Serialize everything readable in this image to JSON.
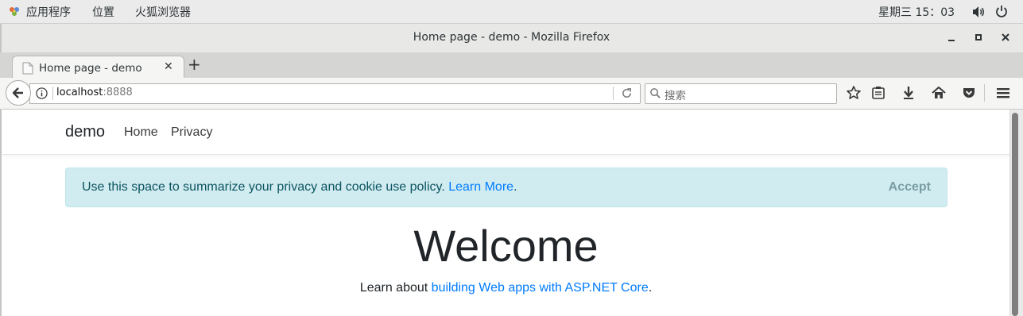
{
  "topbar": {
    "apps_label": "应用程序",
    "places_label": "位置",
    "firefox_label": "火狐浏览器",
    "clock": "星期三 15：03",
    "icons": [
      "apps-icon",
      "volume-icon",
      "power-icon"
    ]
  },
  "window": {
    "title": "Home page - demo - Mozilla Firefox",
    "buttons": [
      "minimize",
      "maximize",
      "close"
    ]
  },
  "tabs": [
    {
      "label": "Home page - demo",
      "active": true
    }
  ],
  "newtab_label": "+",
  "tab_close_label": "✕",
  "urlbar": {
    "host": "localhost",
    "port": ":8888"
  },
  "search": {
    "placeholder": "搜索"
  },
  "toolbar_icons": [
    "bookmark-star-icon",
    "reading-list-icon",
    "downloads-icon",
    "home-icon",
    "pocket-icon",
    "hamburger-menu-icon"
  ],
  "site": {
    "brand": "demo",
    "nav": [
      {
        "label": "Home"
      },
      {
        "label": "Privacy"
      }
    ],
    "cookie": {
      "text": "Use this space to summarize your privacy and cookie use policy. ",
      "link": "Learn More",
      "after": ".",
      "accept": "Accept"
    },
    "heading": "Welcome",
    "learn": {
      "prefix": "Learn about ",
      "link": "building Web apps with ASP.NET Core",
      "suffix": "."
    }
  },
  "colors": {
    "alert_bg": "#d1ecf1",
    "alert_text": "#0c5460",
    "link": "#007bff"
  }
}
